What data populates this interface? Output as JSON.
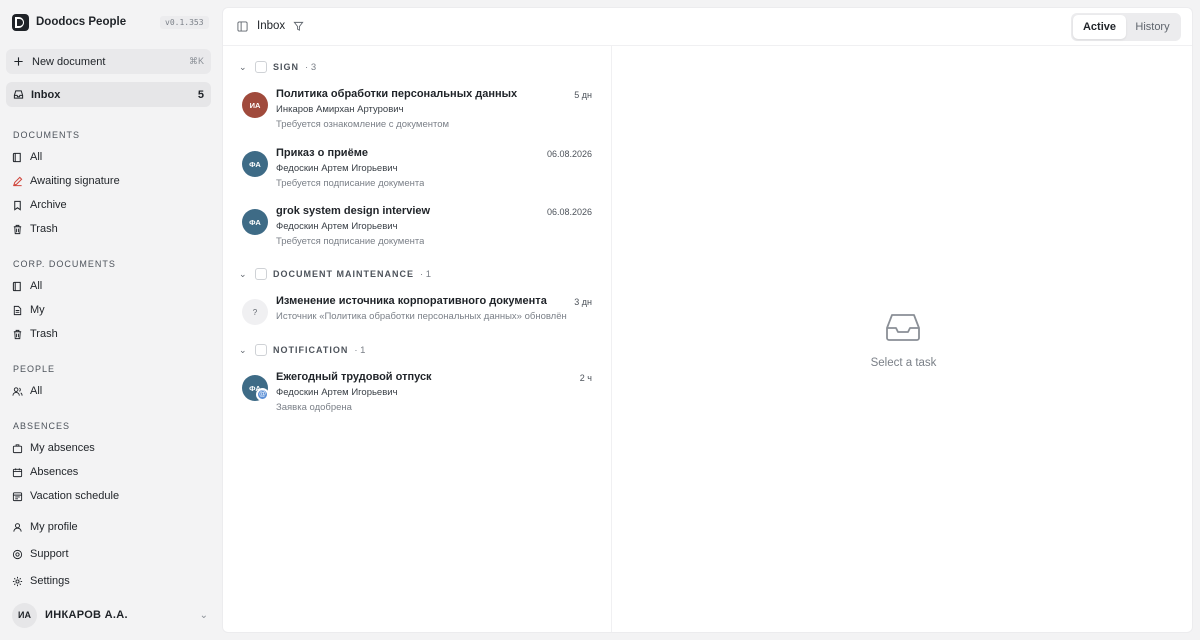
{
  "app": {
    "name": "Doodocs People",
    "version": "v0.1.353"
  },
  "sidebar": {
    "new_document": {
      "label": "New document",
      "shortcut": "⌘K"
    },
    "inbox": {
      "label": "Inbox",
      "count": "5"
    },
    "sections": [
      {
        "title": "DOCUMENTS",
        "items": [
          {
            "label": "All",
            "icon": "book-icon"
          },
          {
            "label": "Awaiting signature",
            "icon": "pen-icon",
            "color": "#d0463c"
          },
          {
            "label": "Archive",
            "icon": "archive-icon"
          },
          {
            "label": "Trash",
            "icon": "trash-icon"
          }
        ]
      },
      {
        "title": "CORP. DOCUMENTS",
        "items": [
          {
            "label": "All",
            "icon": "book-icon"
          },
          {
            "label": "My",
            "icon": "file-icon"
          },
          {
            "label": "Trash",
            "icon": "trash-icon"
          }
        ]
      },
      {
        "title": "PEOPLE",
        "items": [
          {
            "label": "All",
            "icon": "users-icon"
          }
        ]
      },
      {
        "title": "ABSENCES",
        "items": [
          {
            "label": "My absences",
            "icon": "briefcase-icon"
          },
          {
            "label": "Absences",
            "icon": "calendar-icon"
          },
          {
            "label": "Vacation schedule",
            "icon": "schedule-icon"
          }
        ]
      }
    ],
    "bottom": [
      {
        "label": "My profile",
        "icon": "user-icon"
      },
      {
        "label": "Support",
        "icon": "help-icon"
      },
      {
        "label": "Settings",
        "icon": "gear-icon"
      }
    ],
    "user": {
      "initials": "ИА",
      "name": "ИНКАРОВ А.А."
    }
  },
  "topbar": {
    "title": "Inbox",
    "tabs": [
      {
        "label": "Active",
        "active": true
      },
      {
        "label": "History",
        "active": false
      }
    ]
  },
  "groups": [
    {
      "label": "SIGN",
      "count": "· 3",
      "tasks": [
        {
          "initials": "ИА",
          "avatar_color": "#a04a3c",
          "title": "Политика обработки персональных данных",
          "date": "5 дн",
          "author": "Инкаров Амирхан Артурович",
          "status": "Требуется ознакомление с документом"
        },
        {
          "initials": "ФА",
          "avatar_color": "#3e6b86",
          "title": "Приказ о приёме",
          "date": "06.08.2026",
          "author": "Федоскин Артем Игорьевич",
          "status": "Требуется подписание документа"
        },
        {
          "initials": "ФА",
          "avatar_color": "#3e6b86",
          "title": "grok system design interview",
          "date": "06.08.2026",
          "author": "Федоскин Артем Игорьевич",
          "status": "Требуется подписание документа"
        }
      ]
    },
    {
      "label": "DOCUMENT MAINTENANCE",
      "count": "· 1",
      "tasks": [
        {
          "initials": "?",
          "avatar_color": "#f0f0f2",
          "title": "Изменение источника корпоративного документа",
          "date": "3 дн",
          "author": "Источник «Политика обработки персональных данных» обновлён",
          "status": ""
        }
      ]
    },
    {
      "label": "NOTIFICATION",
      "count": "· 1",
      "tasks": [
        {
          "initials": "ФА",
          "avatar_color": "#3e6b86",
          "badge": "@",
          "title": "Ежегодный трудовой отпуск",
          "date": "2 ч",
          "author": "Федоскин Артем Игорьевич",
          "status": "Заявка одобрена"
        }
      ]
    }
  ],
  "detail": {
    "empty_text": "Select a task",
    "icon": "inbox-tray-icon"
  }
}
